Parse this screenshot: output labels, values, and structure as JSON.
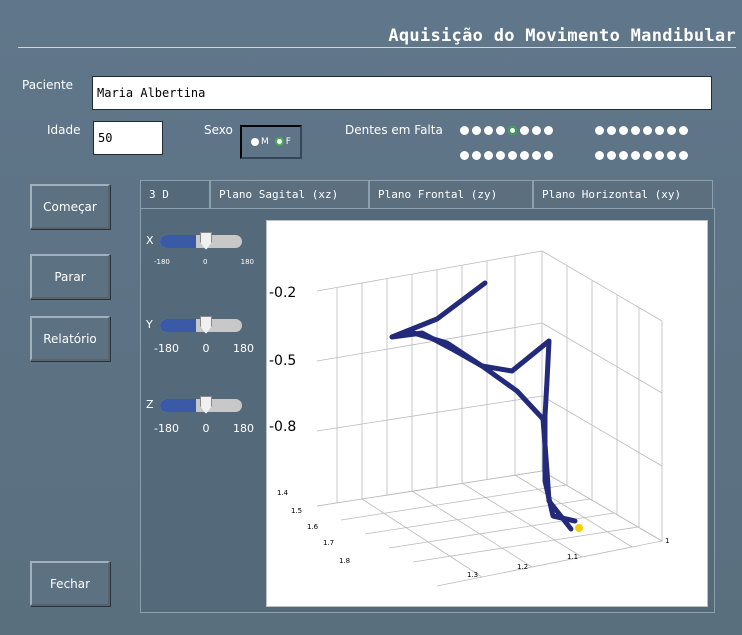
{
  "header": {
    "title": "Aquisição do Movimento Mandibular"
  },
  "patient": {
    "name_label": "Paciente",
    "name_value": "Maria Albertina",
    "age_label": "Idade",
    "age_value": "50",
    "sex_label": "Sexo",
    "sex_options": [
      "M",
      "F"
    ],
    "sex_selected": "F",
    "missing_teeth_label": "Dentes em Falta"
  },
  "buttons": {
    "start": "Começar",
    "stop": "Parar",
    "report": "Relatório",
    "close": "Fechar"
  },
  "tabs": [
    "3 D",
    "Plano Sagital (xz)",
    "Plano Frontal (zy)",
    "Plano Horizontal (xy)"
  ],
  "sliders": [
    {
      "axis": "X",
      "min": "-180",
      "mid": "0",
      "max": "180",
      "value": 0
    },
    {
      "axis": "Y",
      "min": "-180",
      "mid": "0",
      "max": "180",
      "value": 0
    },
    {
      "axis": "Z",
      "min": "-180",
      "mid": "0",
      "max": "180",
      "value": 0
    }
  ],
  "plot": {
    "z_tick_labels": [
      "-0.2",
      "-0.5",
      "-0.8"
    ],
    "left_axis_labels": [
      "1.4",
      "1.5",
      "1.6",
      "1.7",
      "1.8"
    ],
    "bottom_axis_labels": [
      "1.3",
      "1.2",
      "1.1",
      "1"
    ],
    "trace_color": "#232a7a",
    "marker_color": "#f5d000"
  }
}
